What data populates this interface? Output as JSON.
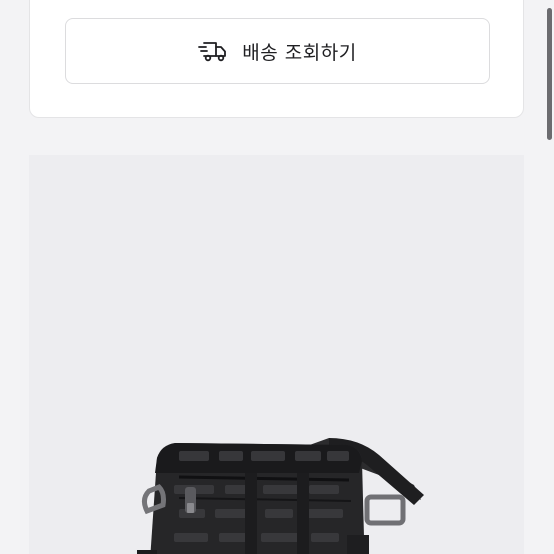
{
  "tracking": {
    "button_label": "배송 조회하기",
    "icon": "delivery-truck-icon"
  },
  "product": {
    "image_subject": "bag-photo"
  },
  "colors": {
    "page_bg": "#f3f3f5",
    "card_bg": "#ffffff",
    "product_bg": "#ededf0",
    "text": "#1f1f22"
  }
}
